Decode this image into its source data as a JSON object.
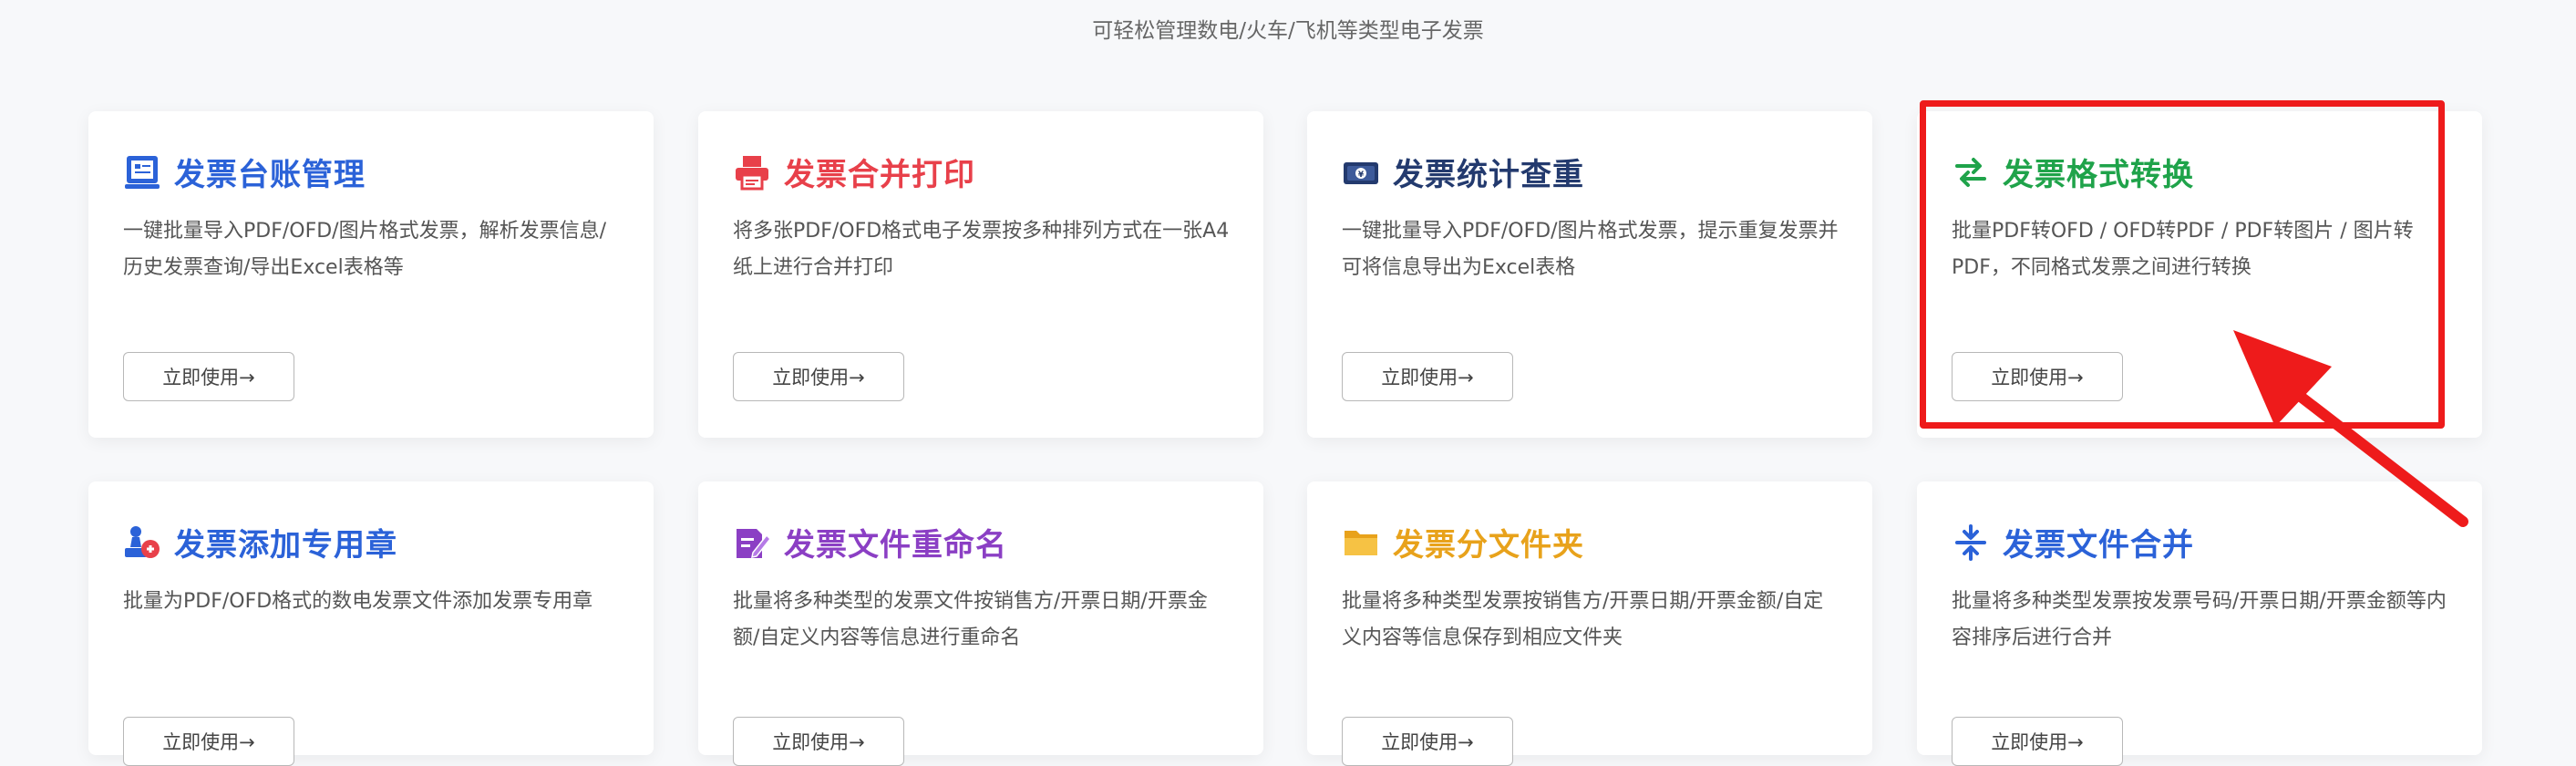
{
  "subtitle": "可轻松管理数电/火车/飞机等类型电子发票",
  "colors": {
    "blue": "#2b62d8",
    "red": "#e8404a",
    "navy": "#233a6e",
    "green": "#1fa34a",
    "purple": "#8b3fc4",
    "orange": "#e8a21b",
    "highlight": "#ee1b1b"
  },
  "cards": [
    {
      "title": "发票台账管理",
      "icon": "ledger-icon",
      "description": "一键批量导入PDF/OFD/图片格式发票，解析发票信息/历史发票查询/导出Excel表格等",
      "button": "立即使用→"
    },
    {
      "title": "发票合并打印",
      "icon": "printer-icon",
      "description": "将多张PDF/OFD格式电子发票按多种排列方式在一张A4纸上进行合并打印",
      "button": "立即使用→"
    },
    {
      "title": "发票统计查重",
      "icon": "cash-stack-icon",
      "description": "一键批量导入PDF/OFD/图片格式发票，提示重复发票并可将信息导出为Excel表格",
      "button": "立即使用→"
    },
    {
      "title": "发票格式转换",
      "icon": "convert-arrows-icon",
      "description": "批量PDF转OFD / OFD转PDF / PDF转图片 / 图片转PDF，不同格式发票之间进行转换",
      "button": "立即使用→"
    },
    {
      "title": "发票添加专用章",
      "icon": "stamp-icon",
      "description": "批量为PDF/OFD格式的数电发票文件添加发票专用章",
      "button": "立即使用→"
    },
    {
      "title": "发票文件重命名",
      "icon": "edit-file-icon",
      "description": "批量将多种类型的发票文件按销售方/开票日期/开票金额/自定义内容等信息进行重命名",
      "button": "立即使用→"
    },
    {
      "title": "发票分文件夹",
      "icon": "folder-icon",
      "description": "批量将多种类型发票按销售方/开票日期/开票金额/自定义内容等信息保存到相应文件夹",
      "button": "立即使用→"
    },
    {
      "title": "发票文件合并",
      "icon": "merge-icon",
      "description": "批量将多种类型发票按发票号码/开票日期/开票金额等内容排序后进行合并",
      "button": "立即使用→"
    }
  ]
}
